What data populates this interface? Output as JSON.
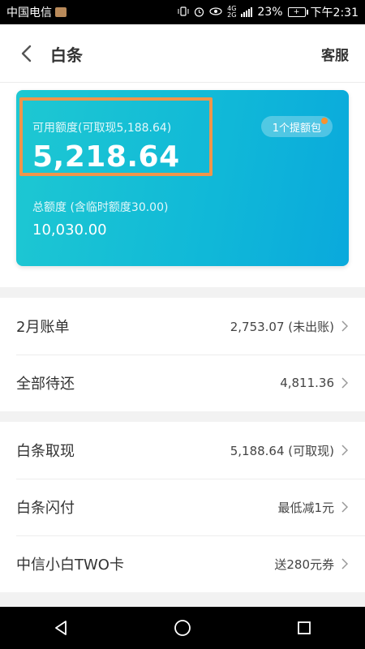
{
  "status_bar": {
    "carrier": "中国电信",
    "network_top": "4G",
    "network_bottom": "2G",
    "battery_percent": "23%",
    "battery_icon_label": "+",
    "time": "下午2:31",
    "icons": [
      "vibrate-icon",
      "alarm-icon",
      "eye-comfort-icon",
      "signal-icon",
      "battery-icon"
    ]
  },
  "header": {
    "title": "白条",
    "service_label": "客服"
  },
  "card": {
    "available_label": "可用额度(可取现5,188.64)",
    "available_value": "5,218.64",
    "pack_label": "1个提额包",
    "total_label": "总额度 (含临时额度30.00)",
    "total_value": "10,030.00",
    "colors": {
      "gradient_start": "#1ec8d2",
      "gradient_end": "#0aa9dc",
      "highlight_border": "#f0954a",
      "badge_dot": "#f7922f"
    }
  },
  "bills": [
    {
      "label": "2月账单",
      "value": "2,753.07 (未出账)"
    },
    {
      "label": "全部待还",
      "value": "4,811.36"
    }
  ],
  "services": [
    {
      "label": "白条取现",
      "value": "5,188.64 (可取现)"
    },
    {
      "label": "白条闪付",
      "value": "最低减1元"
    },
    {
      "label": "中信小白TWO卡",
      "value": "送280元券"
    }
  ]
}
